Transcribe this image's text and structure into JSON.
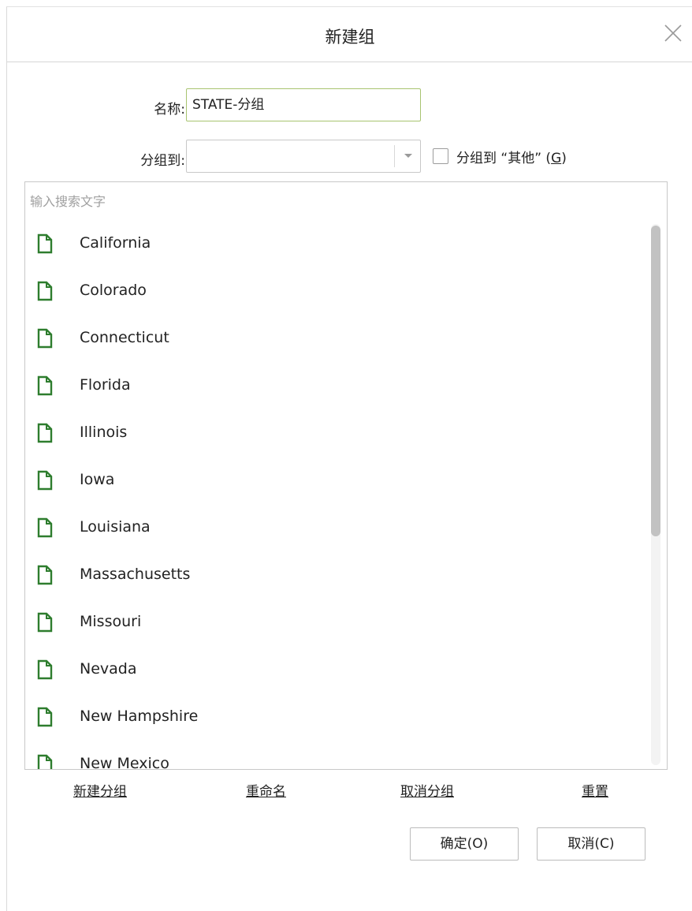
{
  "dialog": {
    "title": "新建组",
    "close_icon": "close-icon"
  },
  "form": {
    "name_label": "名称:",
    "name_value": "STATE-分组",
    "group_to_label": "分组到:",
    "group_to_value": "",
    "other_checkbox_checked": false,
    "other_checkbox_label_prefix": "分组到 “其他” (",
    "other_checkbox_accel": "G",
    "other_checkbox_label_suffix": ")"
  },
  "search": {
    "placeholder": "输入搜索文字"
  },
  "list": {
    "item_icon": "file-icon",
    "icon_color": "#2e7d2e",
    "items": [
      "California",
      "Colorado",
      "Connecticut",
      "Florida",
      "Illinois",
      "Iowa",
      "Louisiana",
      "Massachusetts",
      "Missouri",
      "Nevada",
      "New Hampshire",
      "New Mexico"
    ]
  },
  "actions": {
    "new_group": "新建分组",
    "rename": "重命名",
    "ungroup": "取消分组",
    "reset": "重置"
  },
  "buttons": {
    "ok": "确定(O)",
    "cancel": "取消(C)"
  }
}
